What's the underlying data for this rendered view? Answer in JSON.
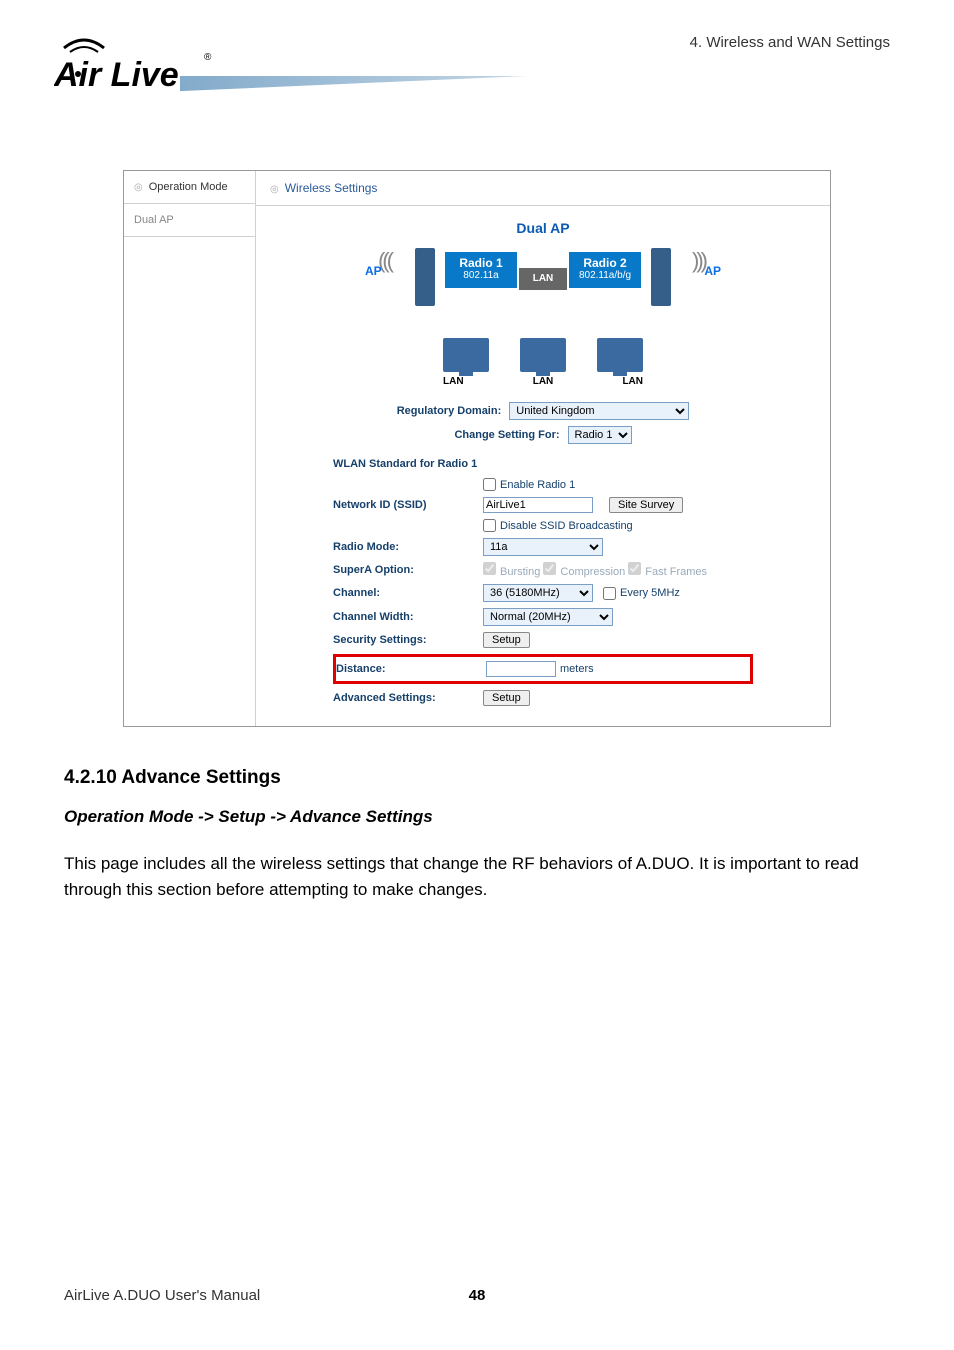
{
  "header": {
    "logo_text": "Air Live",
    "breadcrumb": "4. Wireless and WAN Settings"
  },
  "screenshot": {
    "left": {
      "title": "Operation Mode",
      "item": "Dual AP"
    },
    "panel_title": "Wireless Settings",
    "dual_ap": "Dual AP",
    "diagram": {
      "ap_left": "AP",
      "ap_right": "AP",
      "radio1_title": "Radio 1",
      "radio1_sub": "802.11a",
      "radio2_title": "Radio 2",
      "radio2_sub": "802.11a/b/g",
      "lan_box": "LAN",
      "lan_labels": [
        "LAN",
        "LAN",
        "LAN"
      ]
    },
    "reg": {
      "reg_label": "Regulatory Domain:",
      "reg_value": "United Kingdom",
      "chg_label": "Change Setting For:",
      "chg_value": "Radio 1"
    },
    "wlan_std_hdr": "WLAN Standard for Radio 1",
    "form": {
      "enable_radio": "Enable Radio 1",
      "netid_label": "Network ID (SSID)",
      "netid_value": "AirLive1",
      "site_survey": "Site Survey",
      "disable_ssid": "Disable SSID Broadcasting",
      "radio_mode_label": "Radio Mode:",
      "radio_mode_value": "11a",
      "supera_label": "SuperA Option:",
      "supera_opts": {
        "a": "Bursting",
        "b": "Compression",
        "c": "Fast Frames"
      },
      "channel_label": "Channel:",
      "channel_value": "36 (5180MHz)",
      "every5_label": "Every 5MHz",
      "chw_label": "Channel Width:",
      "chw_value": "Normal (20MHz)",
      "sec_label": "Security Settings:",
      "setup_btn": "Setup",
      "dist_label": "Distance:",
      "dist_unit": "meters",
      "adv_label": "Advanced Settings:",
      "adv_btn": "Setup"
    }
  },
  "section": {
    "heading": "4.2.10 Advance Settings",
    "opmode": "Operation Mode -> Setup -> Advance Settings",
    "body": "This page includes all the wireless settings that change the RF behaviors of A.DUO.    It is important to read through this section before attempting to make changes."
  },
  "footer": {
    "left": "AirLive A.DUO User's Manual",
    "page": "48"
  }
}
